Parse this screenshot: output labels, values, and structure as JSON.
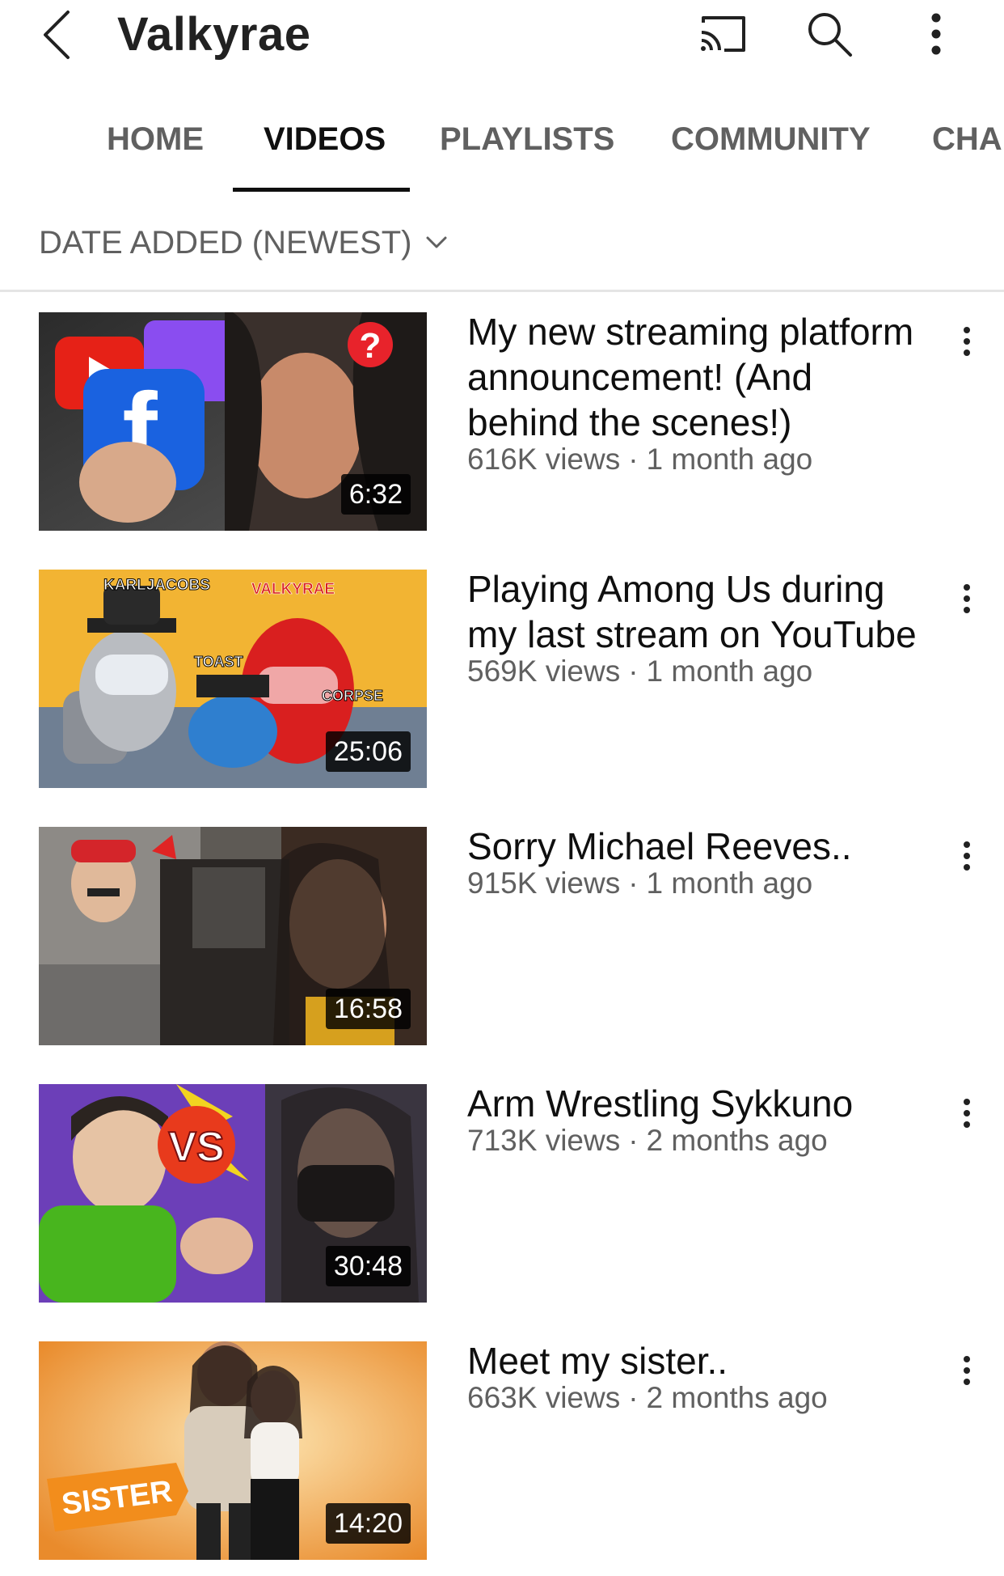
{
  "header": {
    "channel_name": "Valkyrae",
    "icons": [
      "back-arrow-icon",
      "cast-icon",
      "search-icon",
      "more-vertical-icon"
    ]
  },
  "tabs": [
    {
      "label": "HOME",
      "active": false
    },
    {
      "label": "VIDEOS",
      "active": true
    },
    {
      "label": "PLAYLISTS",
      "active": false
    },
    {
      "label": "COMMUNITY",
      "active": false
    },
    {
      "label": "CHAI",
      "active": false
    }
  ],
  "sort": {
    "label": "DATE ADDED (NEWEST)",
    "icon": "chevron-down-icon"
  },
  "videos": [
    {
      "title": "My new streaming platform announcement! (And behind the scenes!)",
      "views": "616K views",
      "age": "1 month ago",
      "duration": "6:32"
    },
    {
      "title": "Playing Among Us during my last stream on YouTube",
      "views": "569K views",
      "age": "1 month ago",
      "duration": "25:06",
      "thumbnail_text": [
        "KARLJACOBS",
        "VALKYRAE",
        "TOAST",
        "CORPSE"
      ]
    },
    {
      "title": "Sorry Michael Reeves..",
      "views": "915K views",
      "age": "1 month ago",
      "duration": "16:58"
    },
    {
      "title": "Arm Wrestling Sykkuno",
      "views": "713K views",
      "age": "2 months ago",
      "duration": "30:48",
      "thumbnail_text": [
        "VS"
      ]
    },
    {
      "title": "Meet my sister..",
      "views": "663K views",
      "age": "2 months ago",
      "duration": "14:20",
      "thumbnail_text": [
        "SISTER"
      ]
    }
  ],
  "separator": "·"
}
